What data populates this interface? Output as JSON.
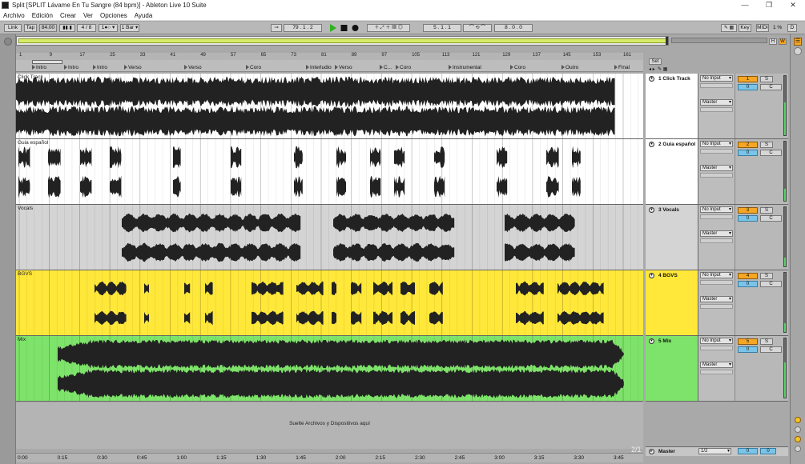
{
  "window": {
    "title": "Split  [SPLIT Lávame En Tu Sangre (84 bpm)] - Ableton Live 10 Suite",
    "minimize": "—",
    "restore": "❐",
    "close": "✕"
  },
  "menu": [
    "Archivo",
    "Edición",
    "Crear",
    "Ver",
    "Opciones",
    "Ayuda"
  ],
  "controlbar": {
    "link": "Link",
    "tap": "Tap",
    "tempo": "84.00",
    "time_sig": "4 / 8",
    "metronome": "1●○ ▾",
    "quantize": "1 Bar ▾",
    "position": "79 .  1 .  2",
    "loop_start": "5 .  1 .  1",
    "loop_length": "8 .  0 .  0",
    "key": "Key",
    "midi": "MIDI",
    "cpu": "1 %",
    "d": "D"
  },
  "overview": {
    "h_label": "H",
    "w_label": "W"
  },
  "ruler": {
    "bars": [
      "1",
      "9",
      "17",
      "25",
      "33",
      "41",
      "49",
      "57",
      "65",
      "73",
      "81",
      "89",
      "97",
      "105",
      "113",
      "121",
      "129",
      "137",
      "145",
      "153",
      "161"
    ]
  },
  "set_label": "Set",
  "locators": [
    "Intro",
    "Intro",
    "Intro",
    "Verso",
    "Verso",
    "Coro",
    "Interludio",
    "Verso",
    "C...",
    "Coro",
    "Instrumental",
    "Coro",
    "Outro",
    "Final"
  ],
  "tracks": [
    {
      "lane_name": "Click Track",
      "header": "1 Click Track",
      "input": "No Input",
      "output": "Master",
      "num": "1",
      "solo": "S",
      "vol": "0",
      "pan": "C",
      "color": "#ffffff",
      "meter": 0.55
    },
    {
      "lane_name": "Guia español",
      "header": "2 Guia español",
      "input": "No Input",
      "output": "Master",
      "num": "2",
      "solo": "S",
      "vol": "0",
      "pan": "C",
      "color": "#ffffff",
      "meter": 0.2
    },
    {
      "lane_name": "Vocals",
      "header": "3 Vocals",
      "input": "No Input",
      "output": "Master",
      "num": "3",
      "solo": "S",
      "vol": "0",
      "pan": "C",
      "color": "#d4d4d4",
      "meter": 0.15
    },
    {
      "lane_name": "BGVS",
      "header": "4 BGVS",
      "input": "No Input",
      "output": "Master",
      "num": "4",
      "solo": "S",
      "vol": "0",
      "pan": "C",
      "color": "#ffe83a",
      "meter": 0.15
    },
    {
      "lane_name": "Mix",
      "header": "5 Mix",
      "input": "No Input",
      "output": "Master",
      "num": "5",
      "solo": "S",
      "vol": "0",
      "pan": "C",
      "color": "#7ee36a",
      "meter": 0.6
    }
  ],
  "dropzone_text": "Suelte Archivos y Dispositivos aquí",
  "timeline": [
    "0:00",
    "0:15",
    "0:30",
    "0:45",
    "1:00",
    "1:15",
    "1:30",
    "1:45",
    "2:00",
    "2:15",
    "2:30",
    "2:45",
    "3:00",
    "3:15",
    "3:30",
    "3:45"
  ],
  "pager": "2/1",
  "master": {
    "label": "Master",
    "fraction": "1/2",
    "vol": "0",
    "pan": "0"
  }
}
